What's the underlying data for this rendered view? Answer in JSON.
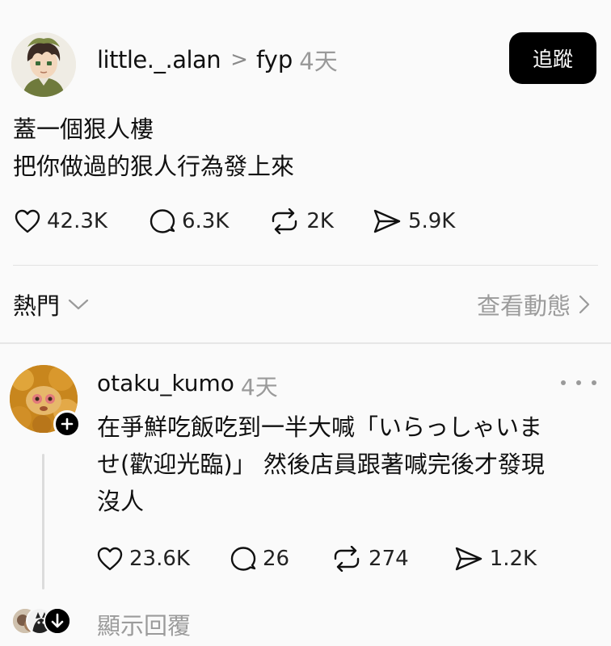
{
  "post": {
    "username": "little._.alan",
    "topic": "fyp",
    "time": "4天",
    "follow_label": "追蹤",
    "text_line1": "蓋一個狠人樓",
    "text_line2": "把你做過的狠人行為發上來",
    "stats": {
      "likes": "42.3K",
      "comments": "6.3K",
      "reposts": "2K",
      "shares": "5.9K"
    }
  },
  "sort": {
    "label": "熱門",
    "view_activity": "查看動態"
  },
  "reply": {
    "username": "otaku_kumo",
    "time": "4天",
    "text_line1": "在爭鮮吃飯吃到一半大喊「いらっしゃいま",
    "text_line2": "せ(歡迎光臨)」 然後店員跟著喊完後才發現",
    "text_line3": "沒人",
    "stats": {
      "likes": "23.6K",
      "comments": "26",
      "reposts": "274",
      "shares": "1.2K"
    }
  },
  "show_replies": "顯示回覆"
}
